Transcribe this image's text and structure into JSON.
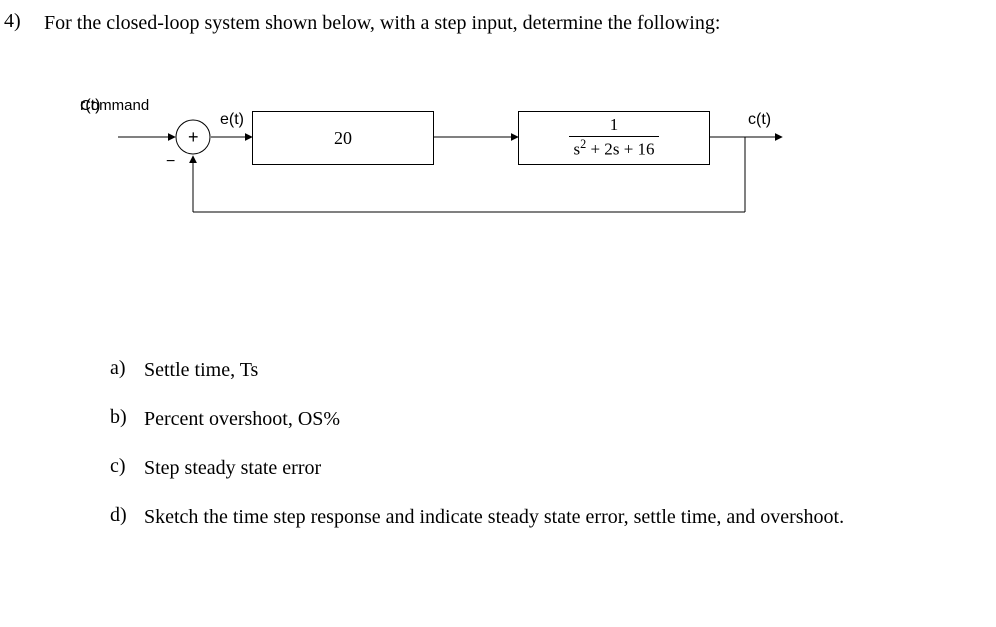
{
  "question": {
    "number": "4)",
    "prompt": "For the closed-loop system shown below, with a step input, determine the following:"
  },
  "diagram": {
    "input_label_top": "Command",
    "input_label_bottom": "r(t)",
    "sum_plus": "+",
    "sum_minus": "−",
    "error_label": "e(t)",
    "gain_value": "20",
    "tf_numerator": "1",
    "tf_denominator_raw": "s^2 + 2s + 16",
    "output_label": "c(t)"
  },
  "sub": {
    "a_letter": "a)",
    "a_text": "Settle time, Ts",
    "b_letter": "b)",
    "b_text": "Percent overshoot, OS%",
    "c_letter": "c)",
    "c_text": "Step steady state error",
    "d_letter": "d)",
    "d_text": "Sketch the time step response and indicate steady state error, settle time, and overshoot."
  }
}
